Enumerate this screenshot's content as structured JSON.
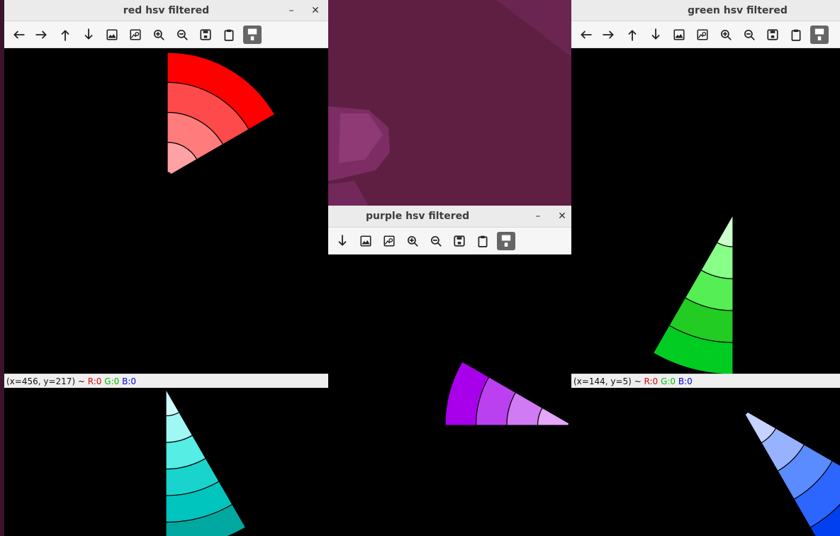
{
  "desktop": {
    "background_color": "#5e1f43"
  },
  "windows": {
    "red": {
      "title": "red hsv filtered",
      "minimize_glyph": "–",
      "close_glyph": "✕",
      "status": {
        "coords": "(x=456, y=217) ~ ",
        "r": "R:0",
        "g": "G:0",
        "b": "B:0"
      }
    },
    "green": {
      "title": "green hsv filtered",
      "status": {
        "coords": "(x=144, y=5) ~ ",
        "r": "R:0",
        "g": "G:0",
        "b": "B:0"
      }
    },
    "purple": {
      "title": "purple hsv filtered",
      "minimize_glyph": "–",
      "close_glyph": "✕"
    },
    "cyan": {},
    "blue": {}
  },
  "toolbar_tools": [
    {
      "name": "pan-left",
      "icon": "arrow-left-icon"
    },
    {
      "name": "pan-right",
      "icon": "arrow-right-icon"
    },
    {
      "name": "pan-up",
      "icon": "arrow-up-icon"
    },
    {
      "name": "pan-down",
      "icon": "arrow-down-icon"
    },
    {
      "name": "zoom-original",
      "icon": "image-icon"
    },
    {
      "name": "zoom-fit",
      "icon": "image-search-icon"
    },
    {
      "name": "zoom-in",
      "icon": "zoom-in-icon"
    },
    {
      "name": "zoom-out",
      "icon": "zoom-out-icon"
    },
    {
      "name": "save",
      "icon": "save-icon"
    },
    {
      "name": "copy",
      "icon": "clipboard-icon"
    },
    {
      "name": "properties",
      "icon": "paint-roller-icon"
    }
  ],
  "palettes": {
    "red": [
      "#ffa2a6",
      "#ff7b7c",
      "#ff4a4b",
      "#ff0000"
    ],
    "green": [
      "#ccffcc",
      "#88ff88",
      "#55ee55",
      "#22cc22",
      "#00cc22"
    ],
    "purple": [
      "#e4a7fa",
      "#d07af4",
      "#bb40f0",
      "#a800ea"
    ],
    "cyan": [
      "#d0ffff",
      "#a0f8f4",
      "#55ede4",
      "#18d4cc",
      "#00c4be",
      "#00a8a0"
    ],
    "blue": [
      "#c6d2ff",
      "#97b2ff",
      "#5b8cff",
      "#2d66ff",
      "#0040f0"
    ]
  }
}
